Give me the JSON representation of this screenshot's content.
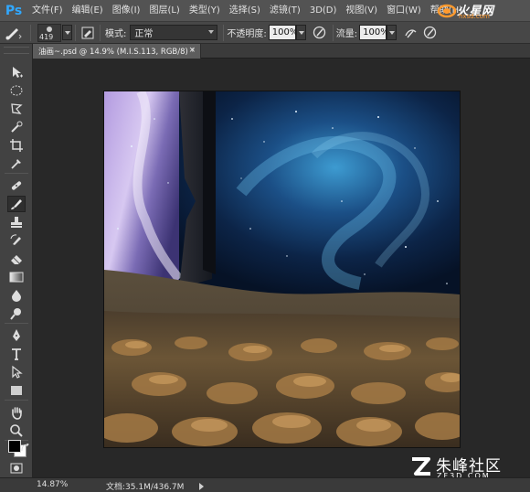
{
  "app": {
    "logo": "Ps"
  },
  "menu": [
    "文件(F)",
    "编辑(E)",
    "图像(I)",
    "图层(L)",
    "类型(Y)",
    "选择(S)",
    "滤镜(T)",
    "3D(D)",
    "视图(V)",
    "窗口(W)",
    "帮助(H)"
  ],
  "brand": {
    "name": "火星网",
    "site": "hxsd.com"
  },
  "options": {
    "brush_size": "419",
    "mode_label": "模式:",
    "mode_value": "正常",
    "opacity_label": "不透明度:",
    "opacity_value": "100%",
    "flow_label": "流量:",
    "flow_value": "100%"
  },
  "document_tab": {
    "title": "油画~.psd @ 14.9% (M.I.S.113, RGB/8) *",
    "close": "×"
  },
  "tools": [
    "move-tool",
    "marquee-tool",
    "lasso-tool",
    "quick-selection-tool",
    "crop-tool",
    "eyedropper-tool",
    "healing-brush-tool",
    "brush-tool",
    "clone-stamp-tool",
    "history-brush-tool",
    "eraser-tool",
    "gradient-tool",
    "blur-tool",
    "dodge-tool",
    "pen-tool",
    "type-tool",
    "path-selection-tool",
    "rectangle-tool",
    "hand-tool",
    "zoom-tool"
  ],
  "colors": {
    "foreground": "#000000",
    "background": "#ffffff",
    "ps_blue": "#31a8ff"
  },
  "status": {
    "zoom": "14.87%",
    "doc": "文档:35.1M/436.7M"
  },
  "watermark": {
    "name": "朱峰社区",
    "site": "ZF3D.COM"
  }
}
